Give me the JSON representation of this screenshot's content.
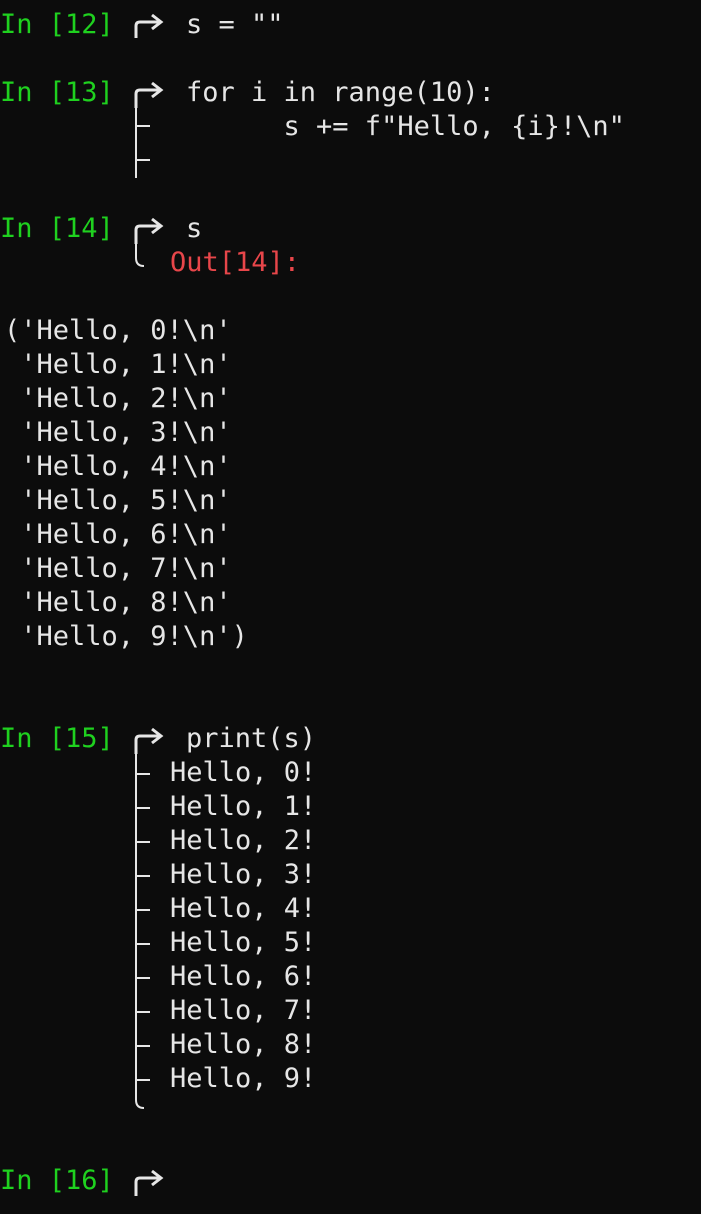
{
  "cells": [
    {
      "prompt": "In [12]",
      "code": [
        "s = \"\""
      ]
    },
    {
      "prompt": "In [13]",
      "code": [
        "for i in range(10):",
        "      s += f\"Hello, {i}!\\n\""
      ]
    },
    {
      "prompt": "In [14]",
      "code": [
        "s"
      ],
      "out_prompt": "Out[14]:",
      "output": [
        "('Hello, 0!\\n'",
        " 'Hello, 1!\\n'",
        " 'Hello, 2!\\n'",
        " 'Hello, 3!\\n'",
        " 'Hello, 4!\\n'",
        " 'Hello, 5!\\n'",
        " 'Hello, 6!\\n'",
        " 'Hello, 7!\\n'",
        " 'Hello, 8!\\n'",
        " 'Hello, 9!\\n')"
      ]
    },
    {
      "prompt": "In [15]",
      "code": [
        "print(s)"
      ],
      "stdout": [
        "Hello, 0!",
        "Hello, 1!",
        "Hello, 2!",
        "Hello, 3!",
        "Hello, 4!",
        "Hello, 5!",
        "Hello, 6!",
        "Hello, 7!",
        "Hello, 8!",
        "Hello, 9!"
      ]
    },
    {
      "prompt": "In [16]",
      "code": [
        ""
      ]
    }
  ],
  "colors": {
    "background": "#0c0c0c",
    "in_prompt": "#1fd11f",
    "out_prompt": "#e8464a",
    "text": "#e6e6e6"
  },
  "icons": {
    "continue_arrow": "arrow-right-curved-icon",
    "tree_branch": "tree-branch-icon"
  }
}
